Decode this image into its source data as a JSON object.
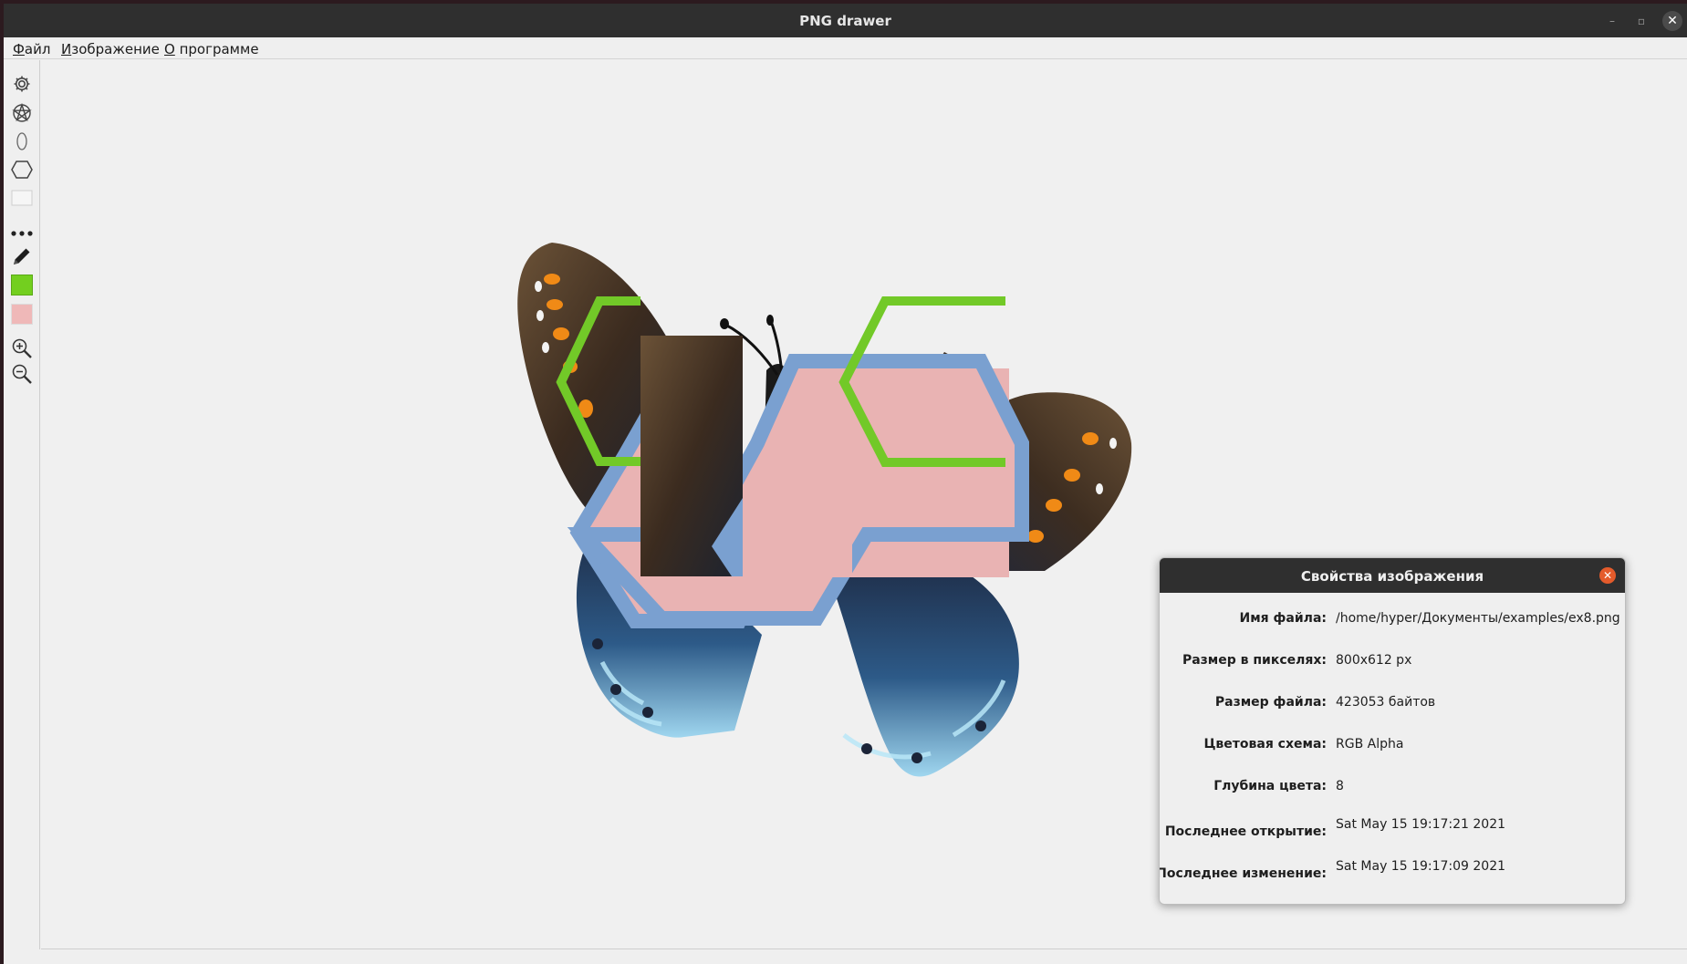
{
  "window": {
    "title": "PNG drawer",
    "minimize_symbol": "–",
    "maximize_symbol": "▫",
    "close_symbol": "✕"
  },
  "menubar": {
    "items": [
      {
        "accel": "Ф",
        "rest": "айл"
      },
      {
        "accel": "И",
        "rest": "зображение"
      },
      {
        "accel": "О",
        "rest": " программе"
      }
    ]
  },
  "toolbar": {
    "tools": [
      "settings-gear-icon",
      "pentagram-icon",
      "ellipse-icon",
      "hexagon-icon",
      "rectangle-icon",
      "more-dots-icon",
      "pencil-icon",
      "line-color-swatch",
      "fill-color-swatch",
      "zoom-in-icon",
      "zoom-out-icon"
    ],
    "line_color": "#73cf1f",
    "fill_color": "#efb8b8"
  },
  "canvas": {
    "shape_fill_color": "#e9b3b3",
    "hexagon_stroke_blue": "#7aa0d0",
    "hexagon_stroke_green": "#72c928"
  },
  "properties_dialog": {
    "title": "Свойства изображения",
    "close_symbol": "✕",
    "rows": [
      {
        "label": "Имя файла:",
        "value": "/home/hyper/Документы/examples/ex8.png"
      },
      {
        "label": "Размер в пикселях:",
        "value": "800x612 px"
      },
      {
        "label": "Размер файла:",
        "value": "423053 байтов"
      },
      {
        "label": "Цветовая схема:",
        "value": "RGB Alpha"
      },
      {
        "label": "Глубина цвета:",
        "value": "8"
      },
      {
        "label": "Последнее открытие:",
        "value": "Sat May 15 19:17:21 2021"
      },
      {
        "label": "Последнее изменение:",
        "value": "Sat May 15 19:17:09 2021"
      }
    ]
  }
}
